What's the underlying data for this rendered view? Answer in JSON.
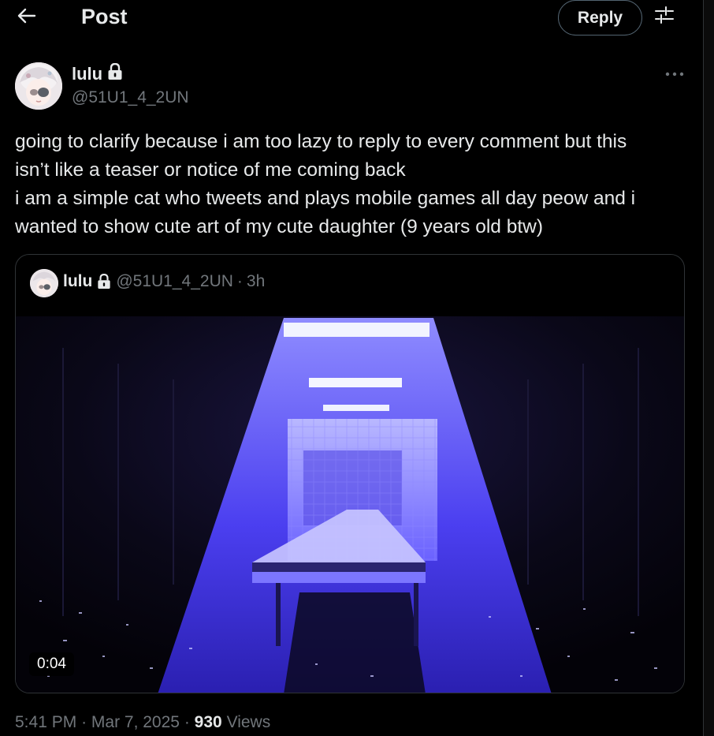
{
  "header": {
    "title": "Post",
    "reply_label": "Reply",
    "back_icon": "arrow-left-icon",
    "settings_icon": "sliders-icon"
  },
  "author": {
    "name": "lulu",
    "handle": "@51U1_4_2UN",
    "protected_icon": "lock-icon"
  },
  "tweet": {
    "lines": [
      "going to clarify because i am too lazy to reply to every comment but this",
      "isn’t like a teaser or notice of me coming back",
      "i am a simple cat who tweets and plays mobile games all day peow and i",
      "wanted to show cute art of my cute daughter (9 years old btw)"
    ]
  },
  "quote": {
    "name": "lulu",
    "handle": "@51U1_4_2UN",
    "separator": "·",
    "time": "3h",
    "video_duration": "0:04"
  },
  "meta": {
    "time": "5:41 PM",
    "sep1": "·",
    "date": "Mar 7, 2025",
    "sep2": "·",
    "views_count": "930",
    "views_label": "Views"
  },
  "colors": {
    "background": "#000000",
    "text": "#e7e9ea",
    "muted": "#71767b",
    "border": "#2f3336",
    "video_glow": "#5a4cff"
  }
}
